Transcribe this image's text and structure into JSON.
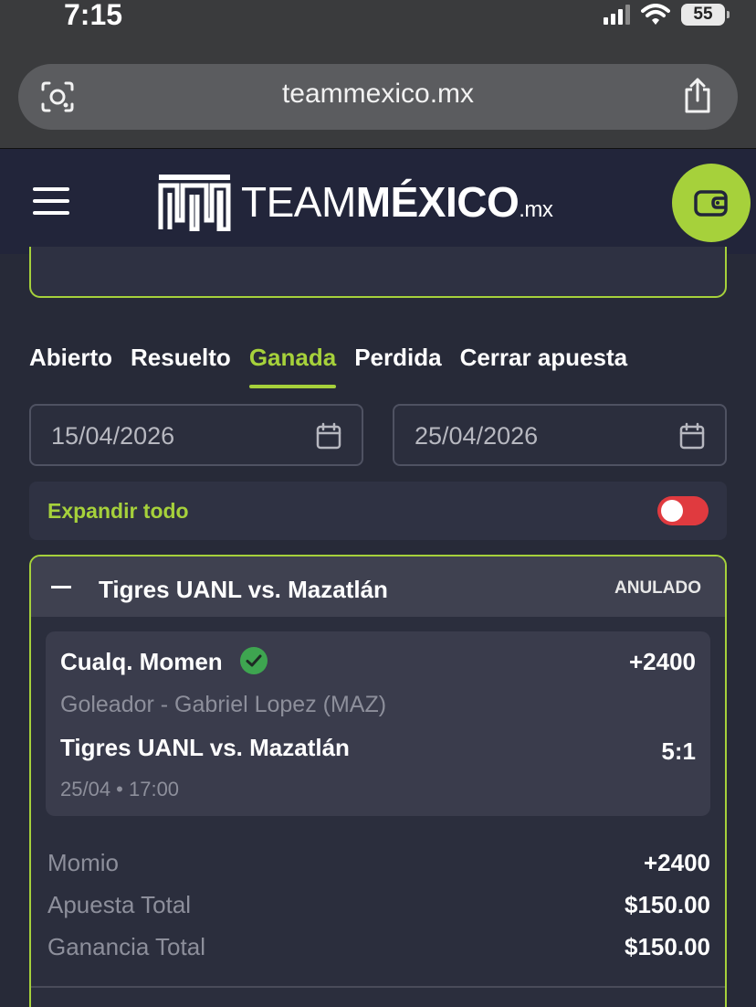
{
  "status_bar": {
    "time": "7:15",
    "battery": "55"
  },
  "browser": {
    "url": "teammexico.mx"
  },
  "header": {
    "logo_light": "TEAM",
    "logo_bold": "MÉXICO",
    "logo_suffix": ".mx",
    "brand_color": "#a6d13b"
  },
  "tabs": [
    {
      "label": "Abierto",
      "active": false
    },
    {
      "label": "Resuelto",
      "active": false
    },
    {
      "label": "Ganada",
      "active": true
    },
    {
      "label": "Perdida",
      "active": false
    },
    {
      "label": "Cerrar apuesta",
      "active": false
    }
  ],
  "filters": {
    "date_from": "15/04/2026",
    "date_to": "25/04/2026",
    "expand_all_label": "Expandir todo",
    "expand_all_on": false
  },
  "bet": {
    "match_title": "Tigres UANL vs. Mazatlán",
    "status": "ANULADO",
    "selection": {
      "market": "Cualq. Momen",
      "odds": "+2400",
      "pick": "Goleador - Gabriel Lopez (MAZ)",
      "event": "Tigres UANL vs. Mazatlán",
      "score": "5:1",
      "datetime": "25/04 • 17:00"
    },
    "summary": [
      {
        "label": "Momio",
        "value": "+2400"
      },
      {
        "label": "Apuesta Total",
        "value": "$150.00"
      },
      {
        "label": "Ganancia Total",
        "value": "$150.00"
      }
    ]
  }
}
